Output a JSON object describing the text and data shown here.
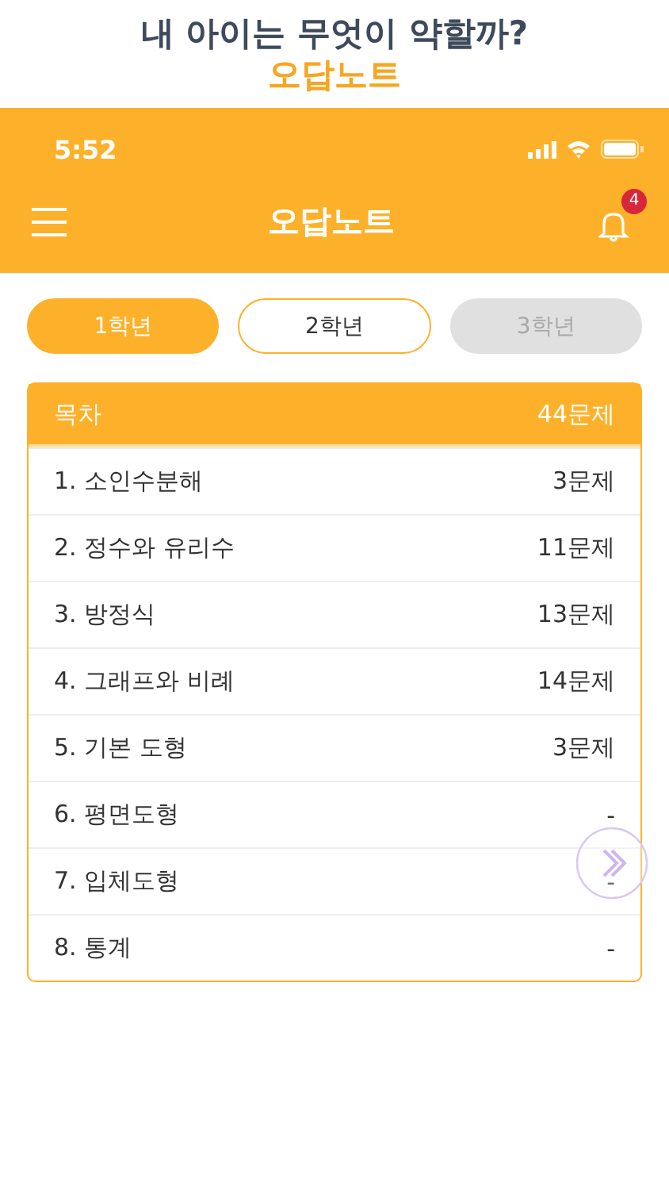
{
  "caption": {
    "headline": "내 아이는 무엇이 약할까?",
    "subtitle": "오답노트"
  },
  "status_bar": {
    "time": "5:52"
  },
  "nav": {
    "title": "오답노트",
    "notification_count": "4"
  },
  "tabs": [
    {
      "label": "1학년",
      "selected": true,
      "disabled": false
    },
    {
      "label": "2학년",
      "selected": false,
      "disabled": false
    },
    {
      "label": "3학년",
      "selected": false,
      "disabled": true
    }
  ],
  "table": {
    "header": {
      "title": "목차",
      "count": "44문제"
    },
    "rows": [
      {
        "title": "1. 소인수분해",
        "count": "3문제"
      },
      {
        "title": "2. 정수와 유리수",
        "count": "11문제"
      },
      {
        "title": "3. 방정식",
        "count": "13문제"
      },
      {
        "title": "4. 그래프와 비례",
        "count": "14문제"
      },
      {
        "title": "5. 기본 도형",
        "count": "3문제"
      },
      {
        "title": "6. 평면도형",
        "count": "-"
      },
      {
        "title": "7. 입체도형",
        "count": "-"
      },
      {
        "title": "8. 통계",
        "count": "-"
      }
    ]
  }
}
